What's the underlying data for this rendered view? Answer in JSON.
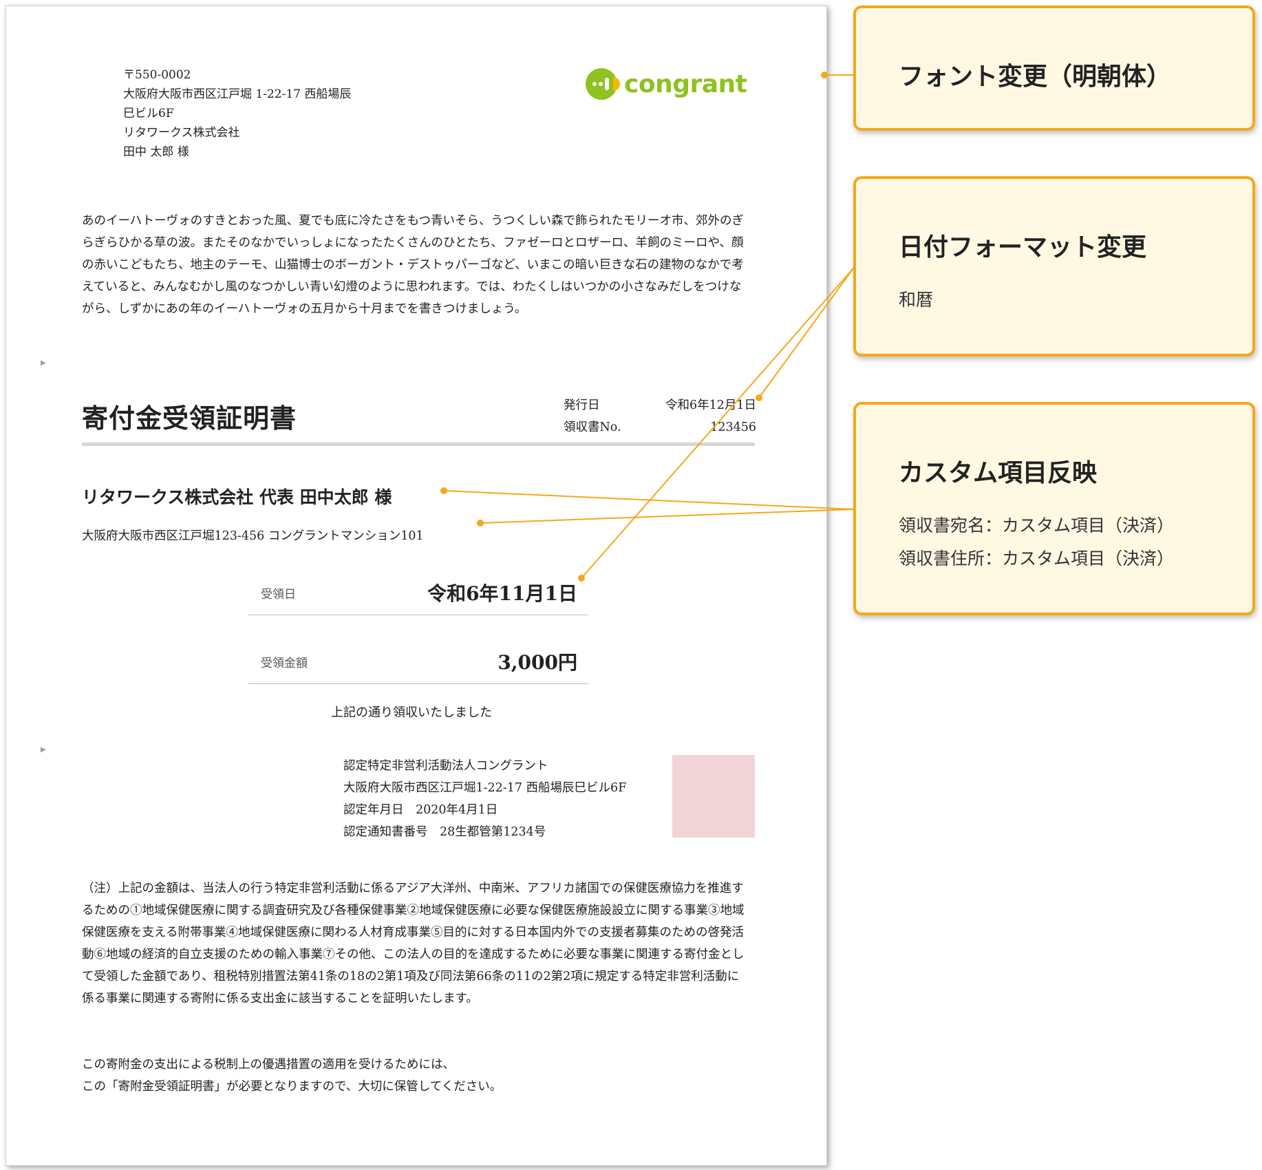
{
  "letter": {
    "postal_code": "〒550-0002",
    "address_line1": "大阪府大阪市西区江戸堀 1-22-17 西船場辰",
    "address_line2": "巳ビル6F",
    "company": "リタワークス株式会社",
    "recipient": "田中 太郎 様"
  },
  "logo": {
    "text": "congrant"
  },
  "intro": "あのイーハトーヴォのすきとおった風、夏でも底に冷たさをもつ青いそら、うつくしい森で飾られたモリーオ市、郊外のぎらぎらひかる草の波。またそのなかでいっしょになったたくさんのひとたち、ファゼーロとロザーロ、羊飼のミーロや、顔の赤いこどもたち、地主のテーモ、山猫博士のボーガント・デストゥパーゴなど、いまこの暗い巨きな石の建物のなかで考えていると、みんなむかし風のなつかしい青い幻燈のように思われます。では、わたくしはいつかの小さなみだしをつけながら、しずかにあの年のイーハトーヴォの五月から十月までを書きつけましょう。",
  "certificate": {
    "title": "寄付金受領証明書",
    "issue_label": "発行日",
    "issue_date": "令和6年12月1日",
    "receipt_no_label": "領収書No.",
    "receipt_no": "123456",
    "recipient_name": "リタワークス株式会社 代表 田中太郎 様",
    "recipient_address": "大阪府大阪市西区江戸堀123-456 コングラントマンション101",
    "received_date_label": "受領日",
    "received_date": "令和6年11月1日",
    "amount_label": "受領金額",
    "amount": "3,000円",
    "received_note": "上記の通り領収いたしました"
  },
  "issuer": {
    "name": "認定特定非営利活動法人コングラント",
    "address": "大阪府大阪市西区江戸堀1-22-17 西船場辰巳ビル6F",
    "certified_date": "認定年月日　2020年4月1日",
    "notice_number": "認定通知書番号　28生都管第1234号"
  },
  "notes": "（注）上記の金額は、当法人の行う特定非営利活動に係るアジア大洋州、中南米、アフリカ諸国での保健医療協力を推進するための①地域保健医療に関する調査研究及び各種保健事業②地域保健医療に必要な保健医療施設設立に関する事業③地域保健医療を支える附帯事業④地域保健医療に関わる人材育成事業⑤目的に対する日本国内外での支援者募集のための啓発活動⑥地域の経済的自立支援のための輸入事業⑦その他、この法人の目的を達成するために必要な事業に関連する寄付金として受領した金額であり、租税特別措置法第41条の18の2第1項及び同法第66条の11の2第2項に規定する特定非営利活動に係る事業に関連する寄附に係る支出金に該当することを証明いたします。",
  "closing": {
    "line1": "この寄附金の支出による税制上の優遇措置の適用を受けるためには、",
    "line2": "この「寄附金受領証明書」が必要となりますので、大切に保管してください。"
  },
  "callouts": {
    "font": {
      "title": "フォント変更（明朝体）"
    },
    "date_format": {
      "title": "日付フォーマット変更",
      "detail": "和暦"
    },
    "custom": {
      "title": "カスタム項目反映",
      "detail1": "領収書宛名：カスタム項目（決済）",
      "detail2": "領収書住所：カスタム項目（決済）"
    }
  },
  "colors": {
    "accent_orange": "#f4a81a",
    "callout_bg": "#fff8e3",
    "logo_green": "#8dc21f",
    "stamp_pink": "#f1d4d8"
  }
}
